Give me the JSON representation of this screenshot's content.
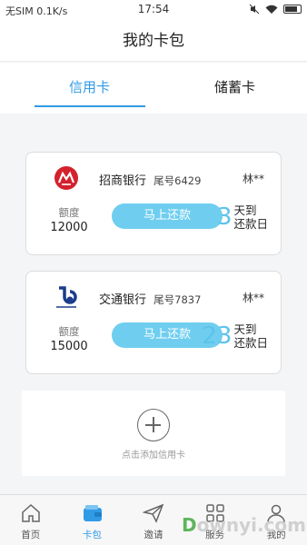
{
  "status_bar": {
    "left": "无SIM 0.1K/s",
    "time": "17:54"
  },
  "header": {
    "title": "我的卡包"
  },
  "tabs": [
    {
      "label": "信用卡",
      "active": true
    },
    {
      "label": "储蓄卡",
      "active": false
    }
  ],
  "cards": [
    {
      "bank": "招商银行",
      "card_no": "尾号6429",
      "holder": "林**",
      "limit_label": "额度",
      "limit_value": "12000",
      "pay_label": "马上还款",
      "days": "3",
      "days_text_1": "天到",
      "days_text_2": "还款日",
      "logo": "cmb-logo-icon",
      "logo_color": "#d3212d"
    },
    {
      "bank": "交通银行",
      "card_no": "尾号7837",
      "holder": "林**",
      "limit_label": "额度",
      "limit_value": "15000",
      "pay_label": "马上还款",
      "days": "23",
      "days_text_1": "天到",
      "days_text_2": "还款日",
      "logo": "bocom-logo-icon",
      "logo_color": "#1a3d8c"
    }
  ],
  "add_card": {
    "label": "点击添加信用卡",
    "icon": "plus-circle-icon"
  },
  "bottom_nav": [
    {
      "label": "首页",
      "icon": "home-icon",
      "active": false
    },
    {
      "label": "卡包",
      "icon": "wallet-icon",
      "active": true
    },
    {
      "label": "邀请",
      "icon": "paper-plane-icon",
      "active": false
    },
    {
      "label": "服务",
      "icon": "grid-icon",
      "active": false
    },
    {
      "label": "我的",
      "icon": "user-icon",
      "active": false
    }
  ],
  "watermark": {
    "text_w": "D",
    "text_rest": "ownyi.com"
  },
  "colors": {
    "accent": "#2f9be6",
    "pay_button": "#6fcef0",
    "days_number": "#5cc3ec"
  }
}
